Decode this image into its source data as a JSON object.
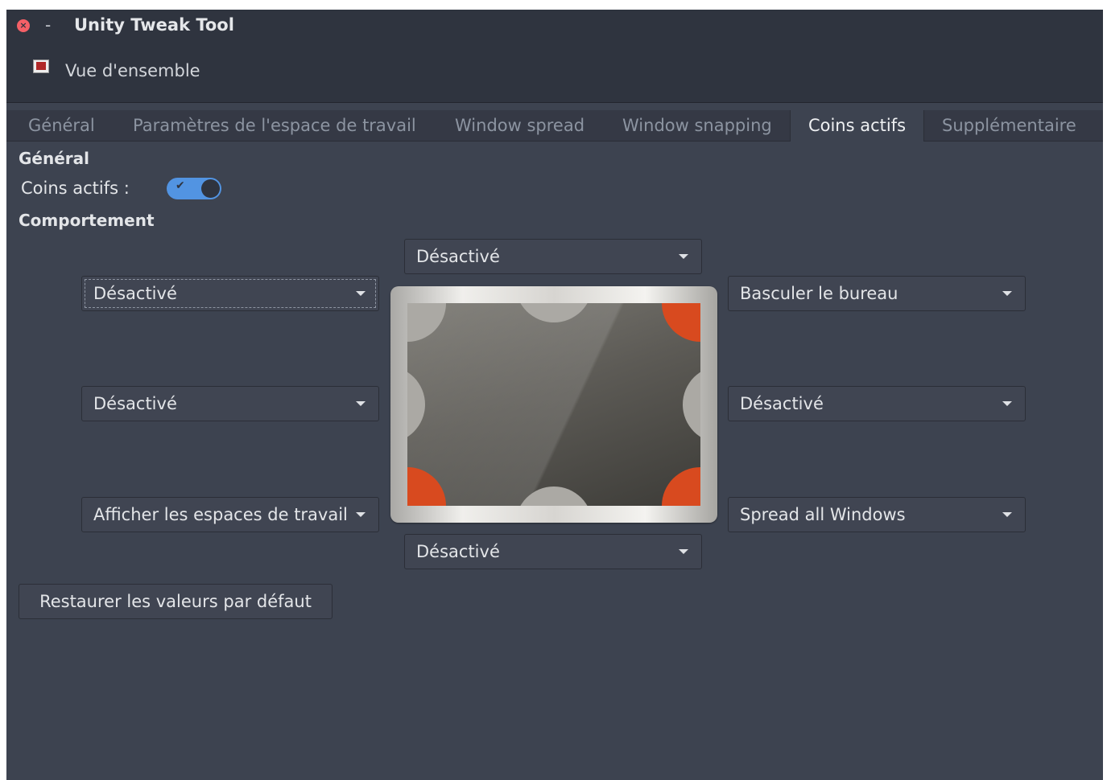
{
  "window": {
    "title": "Unity Tweak Tool",
    "close_glyph": "×",
    "minimize_glyph": "-",
    "overview_label": "Vue d'ensemble"
  },
  "tabs": [
    {
      "label": "Général",
      "active": false
    },
    {
      "label": "Paramètres de l'espace de travail",
      "active": false
    },
    {
      "label": "Window spread",
      "active": false
    },
    {
      "label": "Window snapping",
      "active": false
    },
    {
      "label": "Coins actifs",
      "active": true
    },
    {
      "label": "Supplémentaire",
      "active": false
    }
  ],
  "general": {
    "heading": "Général",
    "hotcorners_label": "Coins actifs :",
    "hotcorners_enabled": true,
    "switch_check": "✔"
  },
  "behavior": {
    "heading": "Comportement",
    "top": "Désactivé",
    "top_left": "Désactivé",
    "top_right": "Basculer le bureau",
    "left": "Désactivé",
    "right": "Désactivé",
    "bottom_left": "Afficher les espaces de travail",
    "bottom_right": "Spread all Windows",
    "bottom": "Désactivé"
  },
  "restore_button": "Restaurer les valeurs par défaut",
  "colors": {
    "background": "#3d4350",
    "titlebar": "#2f343f",
    "accent": "#5294e2",
    "active_corner": "#d84a1f",
    "inactive_corner": "#aba9a4"
  },
  "icons": [
    "close-icon",
    "minimize-icon",
    "overview-icon",
    "dropdown-arrow-icon",
    "check-icon"
  ]
}
